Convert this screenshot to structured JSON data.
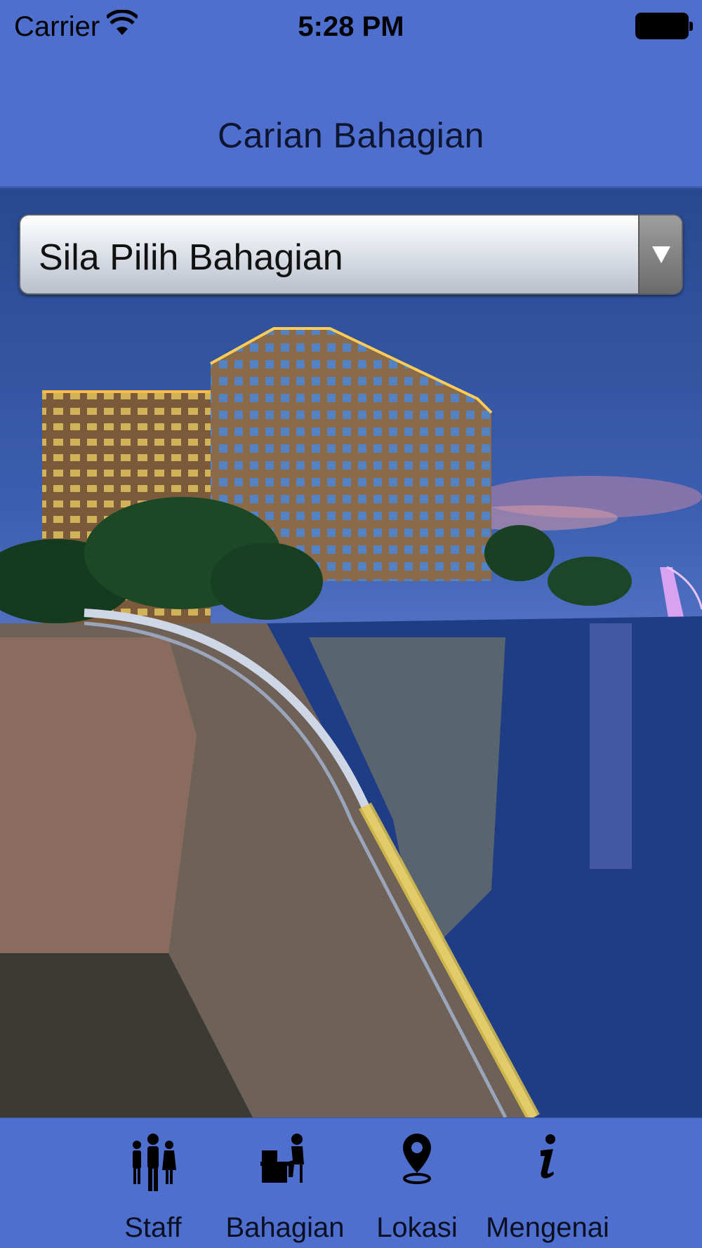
{
  "status_bar": {
    "carrier": "Carrier",
    "time": "5:28 PM"
  },
  "nav": {
    "title": "Carian Bahagian"
  },
  "dropdown": {
    "selected": "Sila Pilih Bahagian"
  },
  "tabs": [
    {
      "label": "Staff",
      "icon": "staff-icon"
    },
    {
      "label": "Bahagian",
      "icon": "desk-icon"
    },
    {
      "label": "Lokasi",
      "icon": "location-pin-icon"
    },
    {
      "label": "Mengenai",
      "icon": "info-icon"
    }
  ],
  "colors": {
    "bar_background": "#4e6fcd",
    "text": "#0e1530"
  }
}
